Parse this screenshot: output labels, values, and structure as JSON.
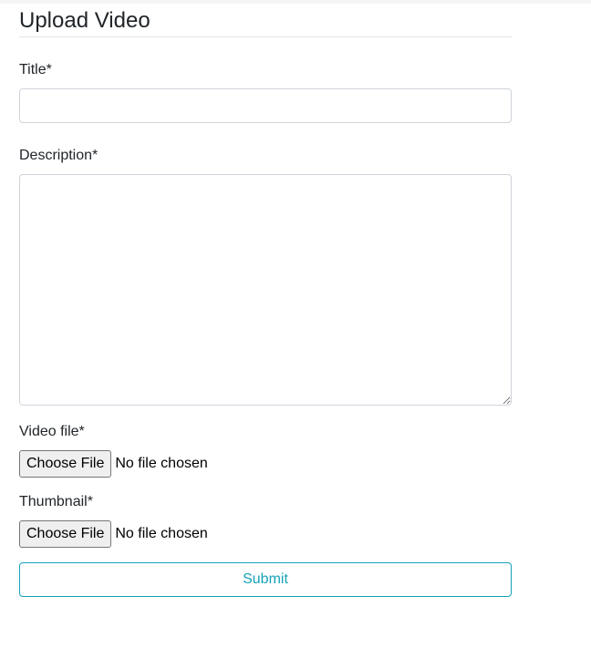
{
  "page": {
    "title": "Upload Video"
  },
  "form": {
    "title_label": "Title*",
    "title_value": "",
    "description_label": "Description*",
    "description_value": "",
    "video_label": "Video file*",
    "video_button": "Choose File",
    "video_status": "No file chosen",
    "thumbnail_label": "Thumbnail*",
    "thumbnail_button": "Choose File",
    "thumbnail_status": "No file chosen",
    "submit_label": "Submit"
  },
  "colors": {
    "accent": "#17a2b8",
    "border": "#ced4da",
    "text": "#212529"
  }
}
